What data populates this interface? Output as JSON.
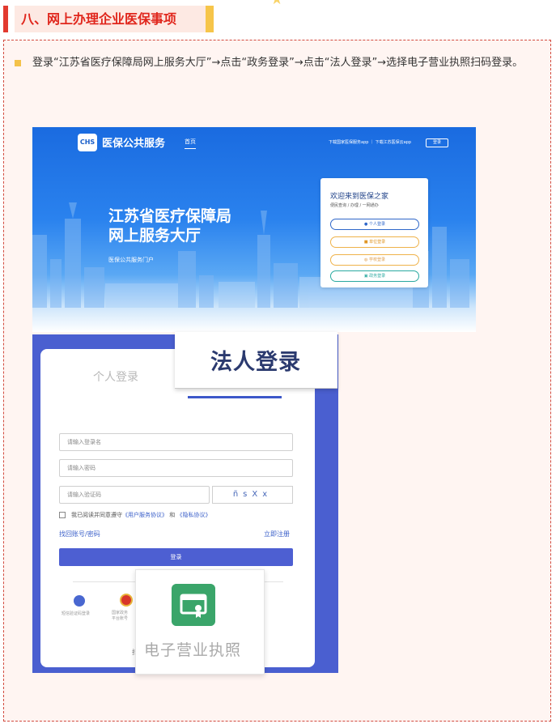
{
  "section": {
    "title": "八、网上办理企业医保事项"
  },
  "step": {
    "text": "登录“江苏省医疗保障局网上服务大厅”→点击“政务登录”→点击“法人登录”→选择电子营业执照扫码登录。"
  },
  "portal": {
    "logo_text": "CHS",
    "brand": "医保公共服务",
    "home_tab": "首页",
    "top_links": "下载国家医保服务app ｜ 下载江苏医保云app",
    "top_login": "登录",
    "hero_title_line1": "江苏省医疗保障局",
    "hero_title_line2": "网上服务大厅",
    "hero_subtitle": "医保公共服务门户",
    "welcome_title": "欢迎来到医保之家",
    "welcome_sub": "便民查询 / 办理 / 一网通办",
    "buttons": [
      "个人登录",
      "单位登录",
      "学校登录",
      "政务登录"
    ]
  },
  "login": {
    "personal_tab": "个人登录",
    "legal_tab": "法人登录",
    "username_placeholder": "请输入登录名",
    "password_placeholder": "请输入密码",
    "captcha_placeholder": "请输入验证码",
    "captcha_text": "ñsXx",
    "agree_prefix": "我已阅读并同意遵守",
    "agree_link1": "《用户服务协议》",
    "agree_and": "和",
    "agree_link2": "《隐私协议》",
    "find_account": "找回账号/密码",
    "register": "立即注册",
    "submit": "登录",
    "alt_login1": "短信验证码登录",
    "alt_login2_line1": "国家政务",
    "alt_login2_line2": "平台账号",
    "footer_char": "扫",
    "license_label": "电子营业执照"
  }
}
